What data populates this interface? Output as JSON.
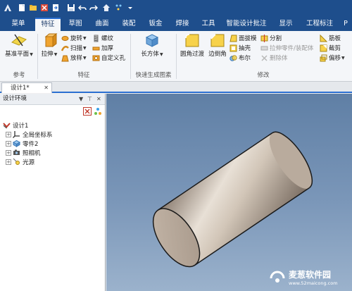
{
  "ribbon_tabs": [
    "菜单",
    "特征",
    "草图",
    "曲面",
    "装配",
    "钣金",
    "焊接",
    "工具",
    "智能设计批注",
    "显示",
    "工程标注",
    "P"
  ],
  "ribbon": {
    "ref_group": {
      "datum_plane": "基准平面",
      "label": "参考"
    },
    "feature_group": {
      "extrude": "拉伸",
      "revolve": "旋转",
      "sweep": "扫描",
      "loft": "放样",
      "thread": "螺纹",
      "thicken": "加厚",
      "custom_hole": "自定义孔",
      "label": "特征"
    },
    "fast_group": {
      "box": "长方体",
      "label": "快速生成图素"
    },
    "modify_group": {
      "fillet": "圆角过渡",
      "chamfer": "边倒角",
      "face_draft": "面拔模",
      "shell": "抽壳",
      "boolean": "布尔",
      "split": "分割",
      "stretch_part": "拉伸零件/装配体",
      "delete_body": "删除体",
      "rib": "筋板",
      "cut": "截剪",
      "offset": "偏移",
      "label": "修改"
    }
  },
  "document_tab": {
    "title": "设计1*"
  },
  "panel": {
    "title": "设计环境",
    "pin": "▼ 𝟰 ✕",
    "tree": [
      {
        "label": "设计1",
        "icon": "design-icon"
      },
      {
        "label": "全局坐标系",
        "icon": "axis-icon"
      },
      {
        "label": "零件2",
        "icon": "part-icon"
      },
      {
        "label": "照相机",
        "icon": "camera-icon"
      },
      {
        "label": "光源",
        "icon": "light-icon"
      }
    ]
  },
  "watermark": {
    "name": "麦葱软件园",
    "url": "www.52maicong.com"
  },
  "colors": {
    "ribbon_bar": "#1e4e8c",
    "active_tab": "#f4f6f9",
    "accent": "#2b6fd1",
    "viewport_top": "#5f7fa5",
    "viewport_bottom": "#9bb2cc"
  }
}
